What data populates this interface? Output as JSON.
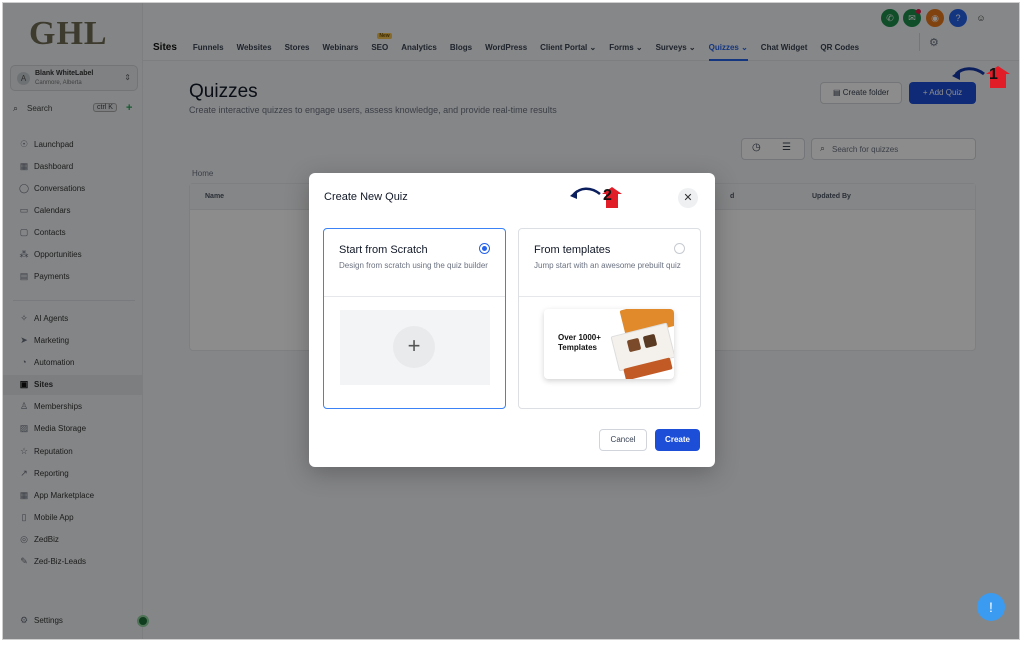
{
  "brand": {
    "logo": "GHL"
  },
  "account": {
    "avatar": "A",
    "name": "Blank WhiteLabel",
    "location": "Canmore, Alberta"
  },
  "sidebar_search": {
    "label": "Search",
    "shortcut": "ctrl K"
  },
  "sidebar": {
    "items": [
      {
        "label": "Launchpad",
        "icon": "rocket-icon",
        "glyph": "☉"
      },
      {
        "label": "Dashboard",
        "icon": "dashboard-icon",
        "glyph": "▦"
      },
      {
        "label": "Conversations",
        "icon": "chat-icon",
        "glyph": "◯"
      },
      {
        "label": "Calendars",
        "icon": "calendar-icon",
        "glyph": "▭"
      },
      {
        "label": "Contacts",
        "icon": "contacts-icon",
        "glyph": "▢"
      },
      {
        "label": "Opportunities",
        "icon": "opportunities-icon",
        "glyph": "⁂"
      },
      {
        "label": "Payments",
        "icon": "payments-icon",
        "glyph": "▤"
      },
      {
        "label": "AI Agents",
        "icon": "sparkle-icon",
        "glyph": "✧"
      },
      {
        "label": "Marketing",
        "icon": "send-icon",
        "glyph": "➤"
      },
      {
        "label": "Automation",
        "icon": "automation-icon",
        "glyph": "◔"
      },
      {
        "label": "Sites",
        "icon": "sites-icon",
        "glyph": "▣"
      },
      {
        "label": "Memberships",
        "icon": "memberships-icon",
        "glyph": "♙"
      },
      {
        "label": "Media Storage",
        "icon": "media-icon",
        "glyph": "▨"
      },
      {
        "label": "Reputation",
        "icon": "star-icon",
        "glyph": "☆"
      },
      {
        "label": "Reporting",
        "icon": "reporting-icon",
        "glyph": "↗"
      },
      {
        "label": "App Marketplace",
        "icon": "marketplace-icon",
        "glyph": "▦"
      },
      {
        "label": "Mobile App",
        "icon": "mobile-icon",
        "glyph": "▯"
      },
      {
        "label": "ZedBiz",
        "icon": "zedbiz-icon",
        "glyph": "◎"
      },
      {
        "label": "Zed-Biz-Leads",
        "icon": "wrench-icon",
        "glyph": "✎"
      }
    ],
    "settings": {
      "label": "Settings",
      "icon": "gear-icon",
      "glyph": "⚙"
    }
  },
  "topnav": {
    "section": "Sites",
    "tabs": [
      "Funnels",
      "Websites",
      "Stores",
      "Webinars",
      "SEO",
      "Analytics",
      "Blogs",
      "WordPress",
      "Client Portal ⌄",
      "Forms ⌄",
      "Surveys ⌄",
      "Quizzes ⌄",
      "Chat Widget",
      "QR Codes"
    ],
    "new_badge": "New",
    "active_tab": "Quizzes ⌄"
  },
  "page": {
    "title": "Quizzes",
    "subtitle": "Create interactive quizzes to engage users, assess knowledge, and provide real-time results",
    "create_folder": "Create folder",
    "add_quiz": "+ Add Quiz",
    "search_placeholder": "Search for quizzes",
    "breadcrumb": "Home",
    "table_headers": [
      "Name",
      "d",
      "Updated By"
    ]
  },
  "modal": {
    "title": "Create New Quiz",
    "close": "✕",
    "options": [
      {
        "title": "Start from Scratch",
        "description": "Design from scratch using the quiz builder",
        "selected": true
      },
      {
        "title": "From templates",
        "description": "Jump start with an awesome prebuilt quiz",
        "selected": false,
        "card_text": "Over 1000+ Templates"
      }
    ],
    "cancel": "Cancel",
    "create": "Create"
  },
  "markers": [
    "1",
    "2"
  ],
  "colors": {
    "primary": "#1d4ed8",
    "active_tab": "#2563eb",
    "overlay": "rgba(0,0,0,0.45)"
  }
}
